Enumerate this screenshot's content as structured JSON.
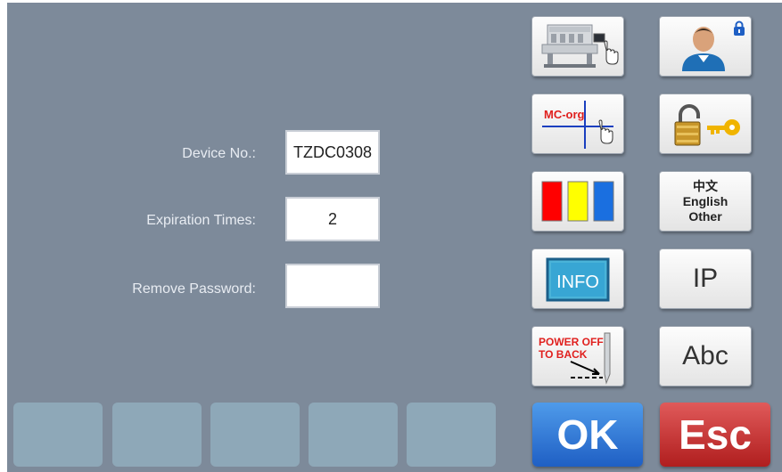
{
  "form": {
    "device_no_label": "Device No.:",
    "device_no_value": "TZDC0308",
    "expiration_label": "Expiration Times:",
    "expiration_value": "2",
    "remove_password_label": "Remove Password:",
    "remove_password_value": ""
  },
  "tiles": {
    "mc_org_label": "MC-org",
    "lang_chinese": "中文",
    "lang_english": "English",
    "lang_other": "Other",
    "info_label": "INFO",
    "ip_label": "IP",
    "power_off_line1": "POWER OFF",
    "power_off_line2": "TO BACK",
    "abc_label": "Abc"
  },
  "buttons": {
    "ok_label": "OK",
    "esc_label": "Esc"
  },
  "icons": [
    "machine-icon",
    "user-icon",
    "lock-icon",
    "crosshair-icon",
    "key-icon",
    "color-bars-icon",
    "info-icon",
    "needle-icon"
  ],
  "colors": {
    "panel": "#7d8a9a",
    "bottom_button": "#8ea8b8",
    "ok": "#2a6fd6",
    "esc": "#c02626",
    "color_bar_red": "#ff0000",
    "color_bar_yellow": "#ffff00",
    "color_bar_blue": "#1a6fe0"
  }
}
